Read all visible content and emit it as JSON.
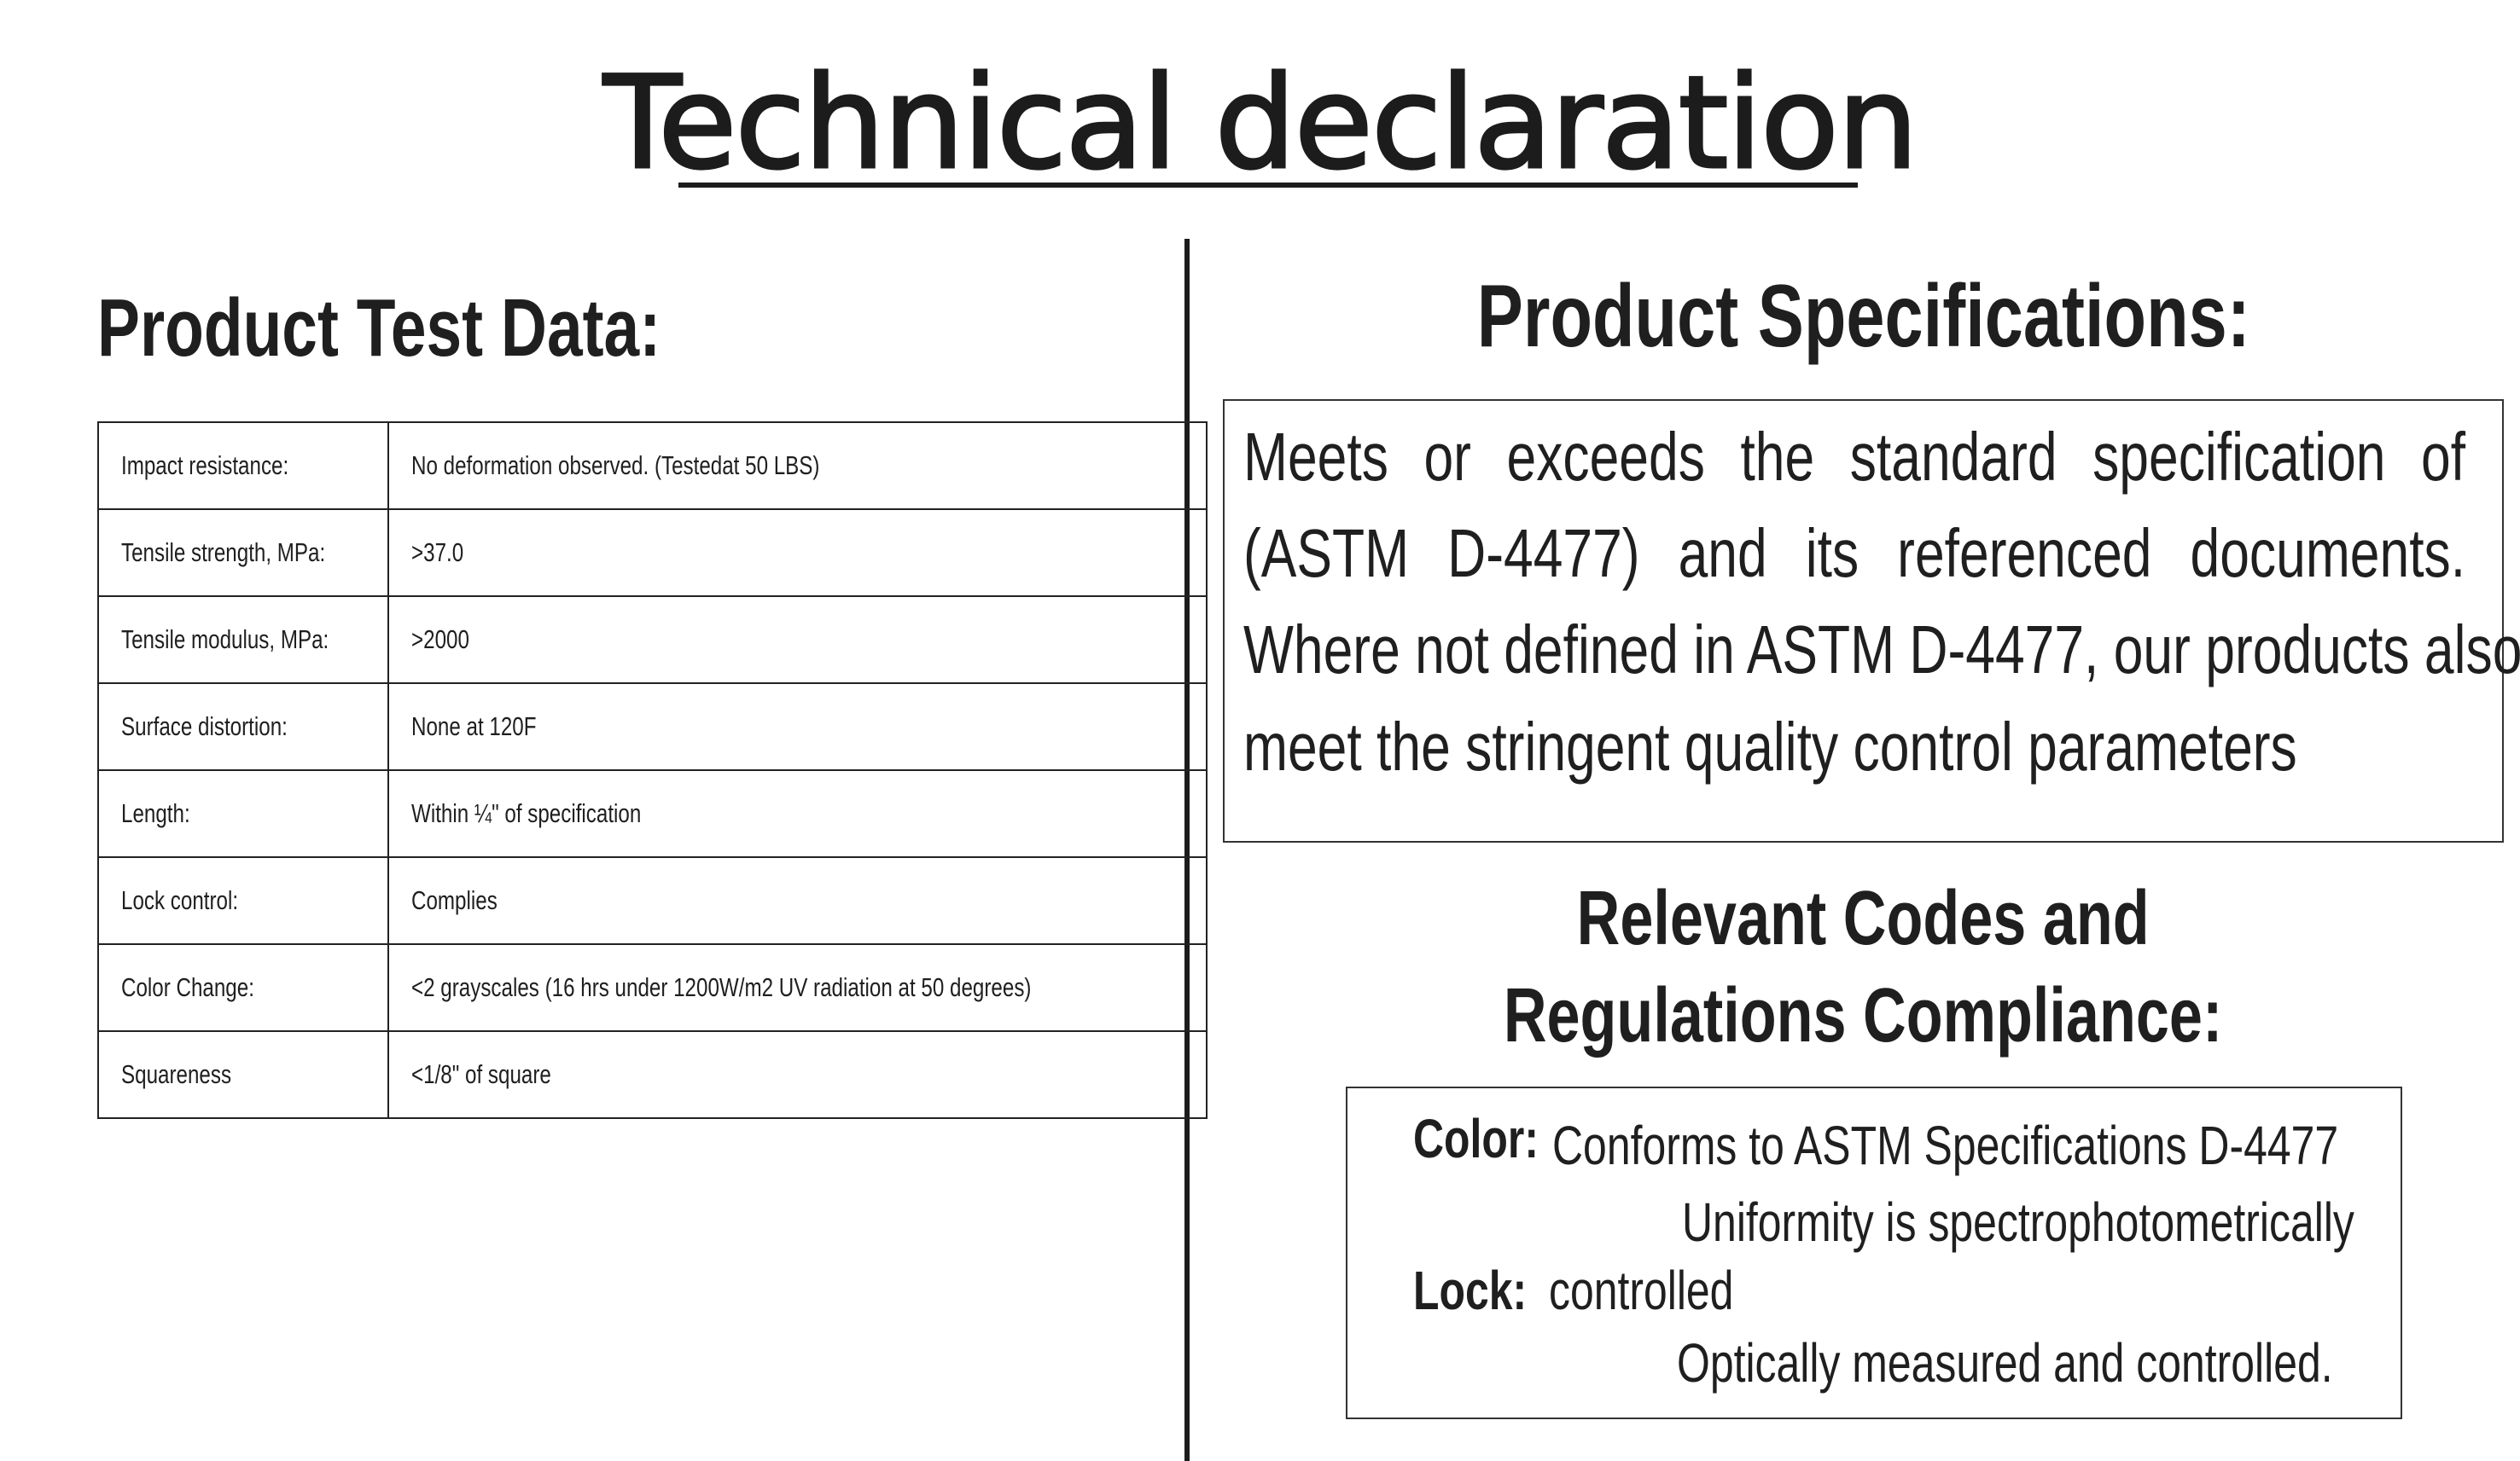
{
  "title": "Technical declaration",
  "test_data": {
    "heading": "Product Test Data:",
    "rows": [
      {
        "label": "Impact resistance:",
        "value": "No deformation observed. (Testedat 50 LBS)"
      },
      {
        "label": "Tensile strength, MPa:",
        "value": ">37.0"
      },
      {
        "label": "Tensile modulus, MPa:",
        "value": ">2000"
      },
      {
        "label": "Surface distortion:",
        "value": "None at 120F"
      },
      {
        "label": "Length:",
        "value": "Within ¼\" of specification"
      },
      {
        "label": "Lock  control:",
        "value": "Complies"
      },
      {
        "label": "Color Change:",
        "value": "<2 grayscales (16 hrs under 1200W/m2 UV radiation  at 50 degrees)"
      },
      {
        "label": "Squareness",
        "value": "<1/8\" of square"
      }
    ]
  },
  "specifications": {
    "heading": "Product Specifications:",
    "lines": [
      "Meets or exceeds the standard specification of",
      "(ASTM D-4477) and its referenced documents.",
      "Where not defined in ASTM D-4477, our products also",
      "meet the stringent quality control parameters"
    ]
  },
  "compliance": {
    "heading_line1": "Relevant Codes and",
    "heading_line2": "Regulations Compliance:",
    "color_label": "Color:",
    "color_text": "Conforms to ASTM Specifications D-4477",
    "uniformity_text": "Uniformity is spectrophotometrically",
    "lock_label": "Lock:",
    "lock_text": "controlled",
    "optical_text": "Optically measured and controlled."
  }
}
